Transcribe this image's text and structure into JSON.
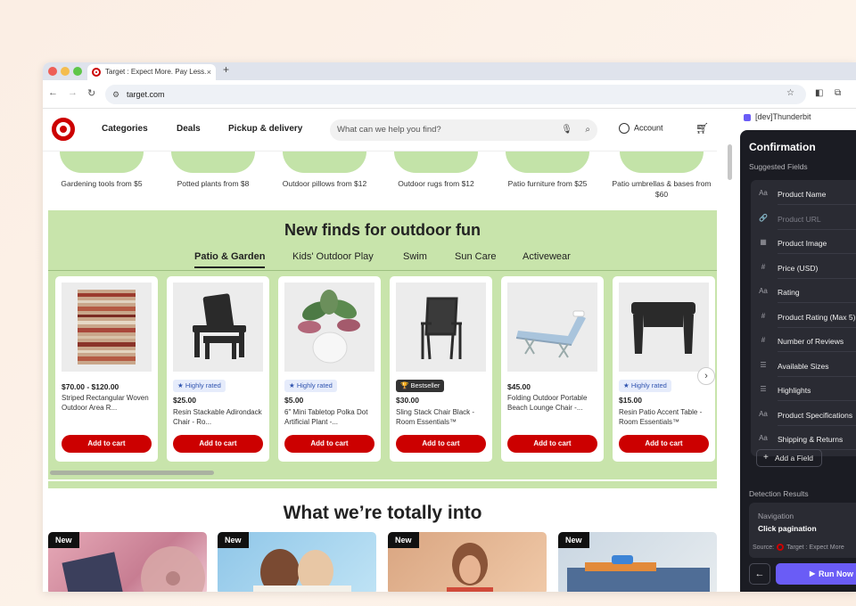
{
  "browser": {
    "tab_title": "Target : Expect More. Pay Less.",
    "tab_close": "×",
    "new_tab": "+",
    "url": "target.com"
  },
  "header": {
    "nav": [
      "Categories",
      "Deals",
      "Pickup & delivery"
    ],
    "search_placeholder": "What can we help you find?",
    "account": "Account"
  },
  "categories": [
    "Gardening tools from $5",
    "Potted plants from $8",
    "Outdoor pillows from $12",
    "Outdoor rugs from $12",
    "Patio furniture from $25",
    "Patio umbrellas & bases from $60"
  ],
  "outdoor": {
    "title": "New finds for outdoor fun",
    "tabs": [
      "Patio & Garden",
      "Kids' Outdoor Play",
      "Swim",
      "Sun Care",
      "Activewear"
    ],
    "active_tab": "Patio & Garden",
    "add_to_cart": "Add to cart",
    "products": [
      {
        "badge": "",
        "price": "$70.00 - $120.00",
        "name": "Striped Rectangular Woven Outdoor Area R..."
      },
      {
        "badge": "Highly rated",
        "price": "$25.00",
        "name": "Resin Stackable Adirondack Chair - Ro..."
      },
      {
        "badge": "Highly rated",
        "price": "$5.00",
        "name": "6\" Mini Tabletop Polka Dot Artificial Plant -..."
      },
      {
        "badge": "Bestseller",
        "price": "$30.00",
        "name": "Sling Stack Chair Black - Room Essentials™"
      },
      {
        "badge": "",
        "price": "$45.00",
        "name": "Folding Outdoor Portable Beach Lounge Chair -..."
      },
      {
        "badge": "Highly rated",
        "price": "$15.00",
        "name": "Resin Patio Accent Table - Room Essentials™"
      }
    ]
  },
  "into": {
    "title": "What we’re totally into",
    "badge": "New"
  },
  "panel": {
    "header": "[dev]Thunderbit",
    "title": "Confirmation",
    "suggested": "Suggested Fields",
    "fields": [
      {
        "icon": "Aa",
        "name": "Product Name",
        "dim": false
      },
      {
        "icon": "🔗",
        "name": "Product URL",
        "dim": true
      },
      {
        "icon": "▦",
        "name": "Product Image",
        "dim": false
      },
      {
        "icon": "#",
        "name": "Price (USD)",
        "dim": false
      },
      {
        "icon": "Aa",
        "name": "Rating",
        "dim": false
      },
      {
        "icon": "#",
        "name": "Product Rating (Max 5)",
        "dim": false
      },
      {
        "icon": "#",
        "name": "Number of Reviews",
        "dim": false
      },
      {
        "icon": "☰",
        "name": "Available Sizes",
        "dim": false
      },
      {
        "icon": "☰",
        "name": "Highlights",
        "dim": false
      },
      {
        "icon": "Aa",
        "name": "Product Specifications",
        "dim": false
      },
      {
        "icon": "Aa",
        "name": "Shipping & Returns",
        "dim": false
      }
    ],
    "add_field": "Add a Field",
    "detection": "Detection Results",
    "navigation": "Navigation",
    "click_pagination": "Click pagination",
    "source": "Source:",
    "source_name": "Target : Expect More",
    "run": "Run Now"
  },
  "colors": {
    "brand": "#cc0000",
    "section_bg": "#c8e4ab",
    "panel_bg": "#1b1c23",
    "run_button": "#6a5cf6"
  }
}
